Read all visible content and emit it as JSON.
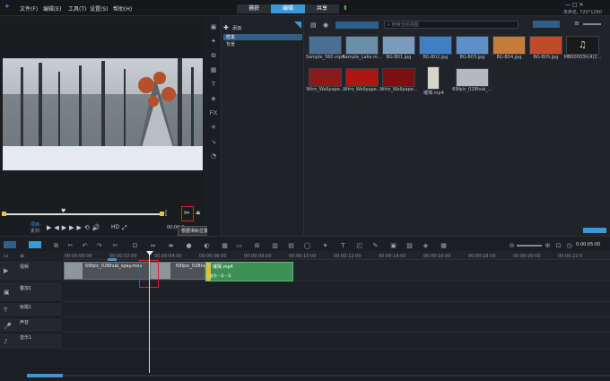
{
  "menu": {
    "file": "文件(F)",
    "edit": "编辑(E)",
    "tools": "工具(T)",
    "settings": "设置(S)",
    "help": "帮助(H)"
  },
  "tabs": {
    "capture": "捕获",
    "edit": "编辑",
    "share": "共享"
  },
  "project_info": "未命名, 720*1280",
  "library": {
    "add_label": "添加",
    "folders": [
      "样本",
      "背景"
    ],
    "search_placeholder": "搜索当前视图",
    "items": [
      {
        "label": "Sample_360.mp4",
        "color": "#4a6f94"
      },
      {
        "label": "Sample_Lake.m...",
        "color": "#6a8fa8"
      },
      {
        "label": "BG-B01.jpg",
        "color": "#7b9bbd"
      },
      {
        "label": "BG-B02.jpg",
        "color": "#3f7fc2"
      },
      {
        "label": "BG-B03.jpg",
        "color": "#5d90c9"
      },
      {
        "label": "BG-B04.jpg",
        "color": "#c77a3a"
      },
      {
        "label": "BG-B05.jpg",
        "color": "#c04a2a"
      },
      {
        "label": "MB00003h(4)2...",
        "color": "#1a1a1a"
      },
      {
        "label": "Nitro_Wallpape...",
        "color": "#8a1b1b"
      },
      {
        "label": "Nitro_Wallpape...",
        "color": "#b01515"
      },
      {
        "label": "Nitro_Wallpape...",
        "color": "#7a1010"
      },
      {
        "label": "璀璨.mp4",
        "color": "#d9d4c8"
      },
      {
        "label": "69fpic_02Bhub_...",
        "color": "#b5b8bc"
      }
    ]
  },
  "player": {
    "project_label": "项目-",
    "clip_label": "素材-",
    "hd": "HD",
    "time": "00:00:0",
    "tooltip": "根据滑轨位置分割素材 (S)"
  },
  "timeline": {
    "timecode": "0:00:05:00",
    "ruler": [
      "00:00:00:00",
      "00:00:02:00",
      "00:00:04:00",
      "00:00:06:00",
      "00:00:08:00",
      "00:00:10:00",
      "00:00:12:00",
      "00:00:14:00",
      "00:00:16:00",
      "00:00:18:00",
      "00:00:20:00",
      "00:00:22:0"
    ],
    "tracks": [
      {
        "name": "视频"
      },
      {
        "name": "叠加1"
      },
      {
        "name": "标题1"
      },
      {
        "name": "声音"
      },
      {
        "name": "音乐1"
      }
    ],
    "clips": {
      "clip1": "69fpic_02Bhub_spay.mov",
      "clip2": "69fpic_02Bhub",
      "clip3": "璀璨.mp4",
      "clip3_sub": "鲸鱼一条一条"
    }
  }
}
